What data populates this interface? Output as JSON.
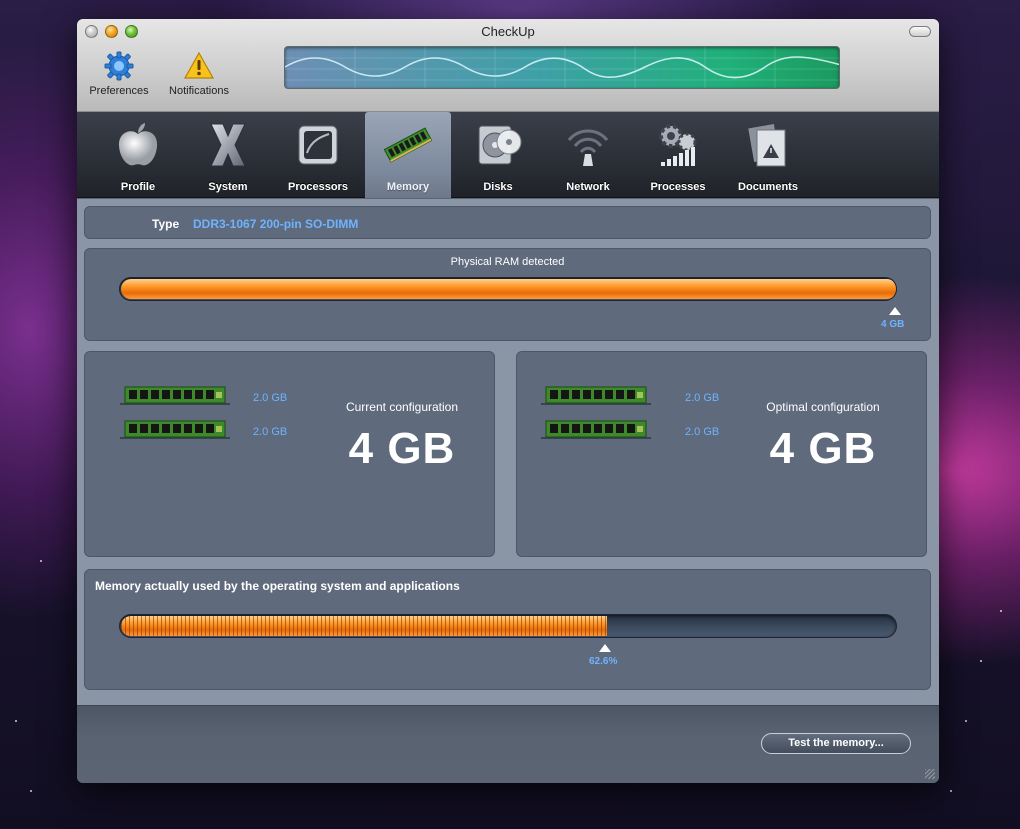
{
  "window": {
    "title": "CheckUp"
  },
  "toolbar": {
    "preferences": {
      "label": "Preferences",
      "icon": "gear-icon"
    },
    "notifications": {
      "label": "Notifications",
      "icon": "warning-icon"
    }
  },
  "tabs": [
    {
      "label": "Profile",
      "icon": "apple-icon",
      "active": false
    },
    {
      "label": "System",
      "icon": "osx-x-icon",
      "active": false
    },
    {
      "label": "Processors",
      "icon": "processor-icon",
      "active": false
    },
    {
      "label": "Memory",
      "icon": "ram-module-icon",
      "active": true
    },
    {
      "label": "Disks",
      "icon": "disk-icon",
      "active": false
    },
    {
      "label": "Network",
      "icon": "wifi-icon",
      "active": false
    },
    {
      "label": "Processes",
      "icon": "gears-icon",
      "active": false
    },
    {
      "label": "Documents",
      "icon": "documents-icon",
      "active": false
    }
  ],
  "memory": {
    "type_label": "Type",
    "type_value": "DDR3-1067 200-pin SO-DIMM",
    "physical": {
      "caption": "Physical RAM detected",
      "value_label": "4 GB",
      "fraction": 1.0
    },
    "current": {
      "title": "Current configuration",
      "total": "4 GB",
      "modules": [
        "2.0 GB",
        "2.0 GB"
      ]
    },
    "optimal": {
      "title": "Optimal configuration",
      "total": "4 GB",
      "modules": [
        "2.0 GB",
        "2.0 GB"
      ]
    },
    "usage": {
      "caption": "Memory actually used by the operating system and applications",
      "percent_label": "62.6%",
      "percent": 62.6
    }
  },
  "actions": {
    "test_button": "Test the memory..."
  },
  "colors": {
    "accent_blue": "#6fb3ff",
    "bar_orange": "#ff9b2c",
    "panel": "#5f6a7c"
  }
}
